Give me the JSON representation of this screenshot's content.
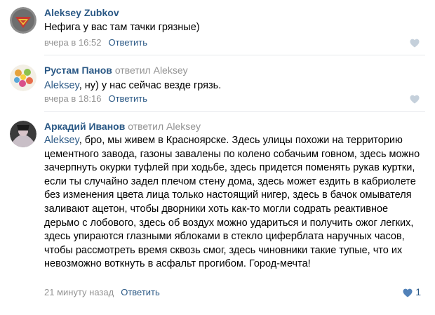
{
  "comments": [
    {
      "author": "Aleksey Zubkov",
      "text": "Нефига у вас там тачки грязные)",
      "time": "вчера в 16:52",
      "reply_label": "Ответить"
    },
    {
      "author": "Рустам Панов",
      "replied_label": "ответил",
      "replied_to": "Aleksey",
      "mention": "Aleksey",
      "text": ", ну) у нас сейчас везде грязь.",
      "time": "вчера в 18:16",
      "reply_label": "Ответить"
    },
    {
      "author": "Аркадий Иванов",
      "replied_label": "ответил",
      "replied_to": "Aleksey",
      "mention": "Aleksey",
      "text": ", бро, мы живем в Красноярске. Здесь улицы похожи на территорию цементного завода, газоны завалены по колено собачьим говном, здесь можно зачерпнуть окурки туфлей при ходьбе, здесь придется поменять рукав куртки, если ты случайно задел плечом стену дома, здесь может ездить в кабриолете без изменения цвета лица только настоящий нигер, здесь в бачок омывателя заливают ацетон, чтобы дворники хоть как-то могли содрать реактивное дерьмо с лобового, здесь об воздух можно удариться и получить ожог легких, здесь упираются глазными яблоками в стекло циферблата наручных часов, чтобы рассмотреть время сквозь смог, здесь чиновники такие тупые, что их невозможно воткнуть в асфальт прогибом. Город-мечта!",
      "time": "21 минуту назад",
      "reply_label": "Ответить",
      "likes": "1"
    }
  ],
  "icons": {
    "like": "heart-icon"
  },
  "colors": {
    "link": "#2a5885",
    "muted": "#939393",
    "like_inactive": "#c5d0db",
    "like_active": "#5181b8"
  }
}
